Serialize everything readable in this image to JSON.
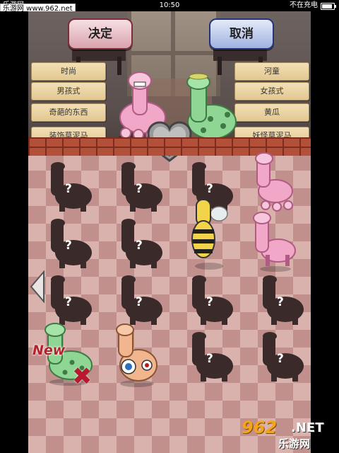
{
  "status_bar": {
    "carrier": "乐游网",
    "time": "10:50",
    "battery": "不在充电"
  },
  "watermark_top": "乐游网 www.962.net",
  "watermark_bottom": {
    "number": "962",
    "suffix": ".NET",
    "site": "乐游网"
  },
  "buttons": {
    "confirm": "决定",
    "cancel": "取消"
  },
  "left_tags": [
    "时尚",
    "男孩式",
    "奇葩的东西",
    "装饰草泥马"
  ],
  "right_tags": [
    "河童",
    "女孩式",
    "黄瓜",
    "妖怪草泥马"
  ],
  "grid_unknown_mark": "?",
  "new_badge": "New",
  "remove_mark": "✖",
  "colors": {
    "confirm_border": "#7b2e3a",
    "cancel_border": "#27347a",
    "tag_bg": "#f3e0b6",
    "background_check": "#d9b2ad"
  },
  "icons": {
    "left": "left-arrow-icon",
    "heart": "heart-meter-icon"
  }
}
